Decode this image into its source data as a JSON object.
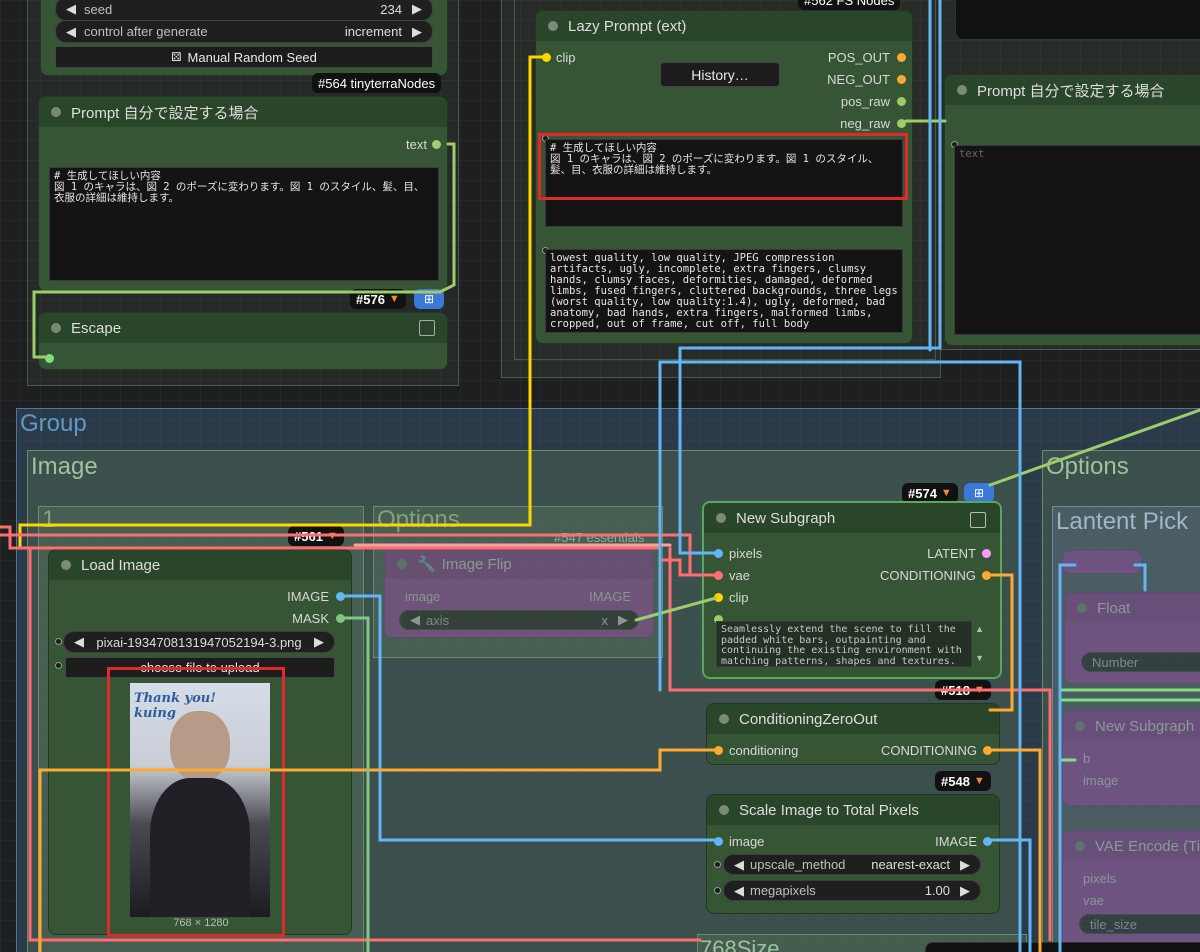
{
  "colors": {
    "image": "#64b5f6",
    "vae": "#ff6e6e",
    "clip": "#ffd500",
    "conditioning": "#ffa931",
    "latent": "#ff9cf9",
    "string": "#80c080",
    "mask": "#81c784",
    "red_frame": "#e0292a"
  },
  "top_left_node": {
    "seed_label": "seed",
    "seed_value": "234",
    "control_label": "control after generate",
    "control_value": "increment",
    "manual_seed_button": "Manual Random Seed",
    "manual_seed_icon": "dice-icon",
    "badge": "#564 tinyterraNodes"
  },
  "prompt_node_left": {
    "title": "Prompt 自分で設定する場合",
    "output_label": "text",
    "text": "# 生成してほしい内容\n図 1 のキャラは、図 2 のポーズに変わります。図 1 のスタイル、髪、目、衣服の詳細は維持します。",
    "badge": "#576",
    "badge_icon": "fox-icon",
    "subgraph_icon": "sitemap-icon"
  },
  "escape_node": {
    "title": "Escape",
    "expand_icon": "expand-icon"
  },
  "lazy_prompt": {
    "title": "Lazy Prompt (ext)",
    "input_clip": "clip",
    "history_button": "History…",
    "outputs": [
      "POS_OUT",
      "NEG_OUT",
      "pos_raw",
      "neg_raw"
    ],
    "positive_text": "# 生成してほしい内容\n図 1 のキャラは、図 2 のポーズに変わります。図 1 のスタイル、髪、目、衣服の詳細は維持します。",
    "negative_text": "lowest quality, low quality, JPEG compression artifacts, ugly, incomplete, extra fingers, clumsy hands, clumsy faces, deformities, damaged, deformed limbs, fused fingers, cluttered backgrounds, three legs\n(worst quality, low quality:1.4), ugly, deformed, bad anatomy, bad hands, extra fingers, malformed limbs, cropped, out of frame, cut off, full body",
    "top_badge": "#562 FS Nodes"
  },
  "prompt_node_right": {
    "title": "Prompt 自分で設定する場合",
    "placeholder": "text"
  },
  "groups": {
    "outer": "Group",
    "image": "Image",
    "options_right": "Options",
    "sub_1": "1",
    "sub_options": "Options",
    "lantent_pick": "Lantent Pick",
    "bottom": "768Size"
  },
  "load_image": {
    "title": "Load Image",
    "badge": "#561",
    "outputs": [
      "IMAGE",
      "MASK"
    ],
    "filename": "pixai-1934708131947052194-3.png",
    "upload_button": "choose file to upload",
    "dimensions": "768 × 1280",
    "thumb_caption": "Thank you!\nkuing"
  },
  "image_flip": {
    "title": "Image Flip",
    "badge": "#547 essentials",
    "input": "image",
    "output": "IMAGE",
    "axis_label": "axis",
    "axis_value": "x",
    "wrench_icon": "wrench-icon"
  },
  "new_subgraph": {
    "title": "New Subgraph",
    "badge": "#574",
    "inputs": [
      "pixels",
      "vae",
      "clip"
    ],
    "outputs": [
      "LATENT",
      "CONDITIONING"
    ],
    "text": "Seamlessly extend the scene to fill the padded white bars, outpainting and continuing the existing environment with matching patterns, shapes and textures. Do not modify or repaint"
  },
  "cond_zero": {
    "title": "ConditioningZeroOut",
    "badge": "#518",
    "input": "conditioning",
    "output": "CONDITIONING"
  },
  "scale_image": {
    "title": "Scale Image to Total Pixels",
    "badge": "#548",
    "input": "image",
    "output": "IMAGE",
    "upscale_label": "upscale_method",
    "upscale_value": "nearest-exact",
    "megapixels_label": "megapixels",
    "megapixels_value": "1.00"
  },
  "right_faded": {
    "float_title": "Float",
    "number_label": "Number",
    "subgraph_title": "New Subgraph",
    "inputs": [
      "b",
      "image"
    ],
    "vae_encode_title": "VAE Encode (Ti",
    "vae_inputs": [
      "pixels",
      "vae"
    ],
    "tile_label": "tile_size"
  }
}
